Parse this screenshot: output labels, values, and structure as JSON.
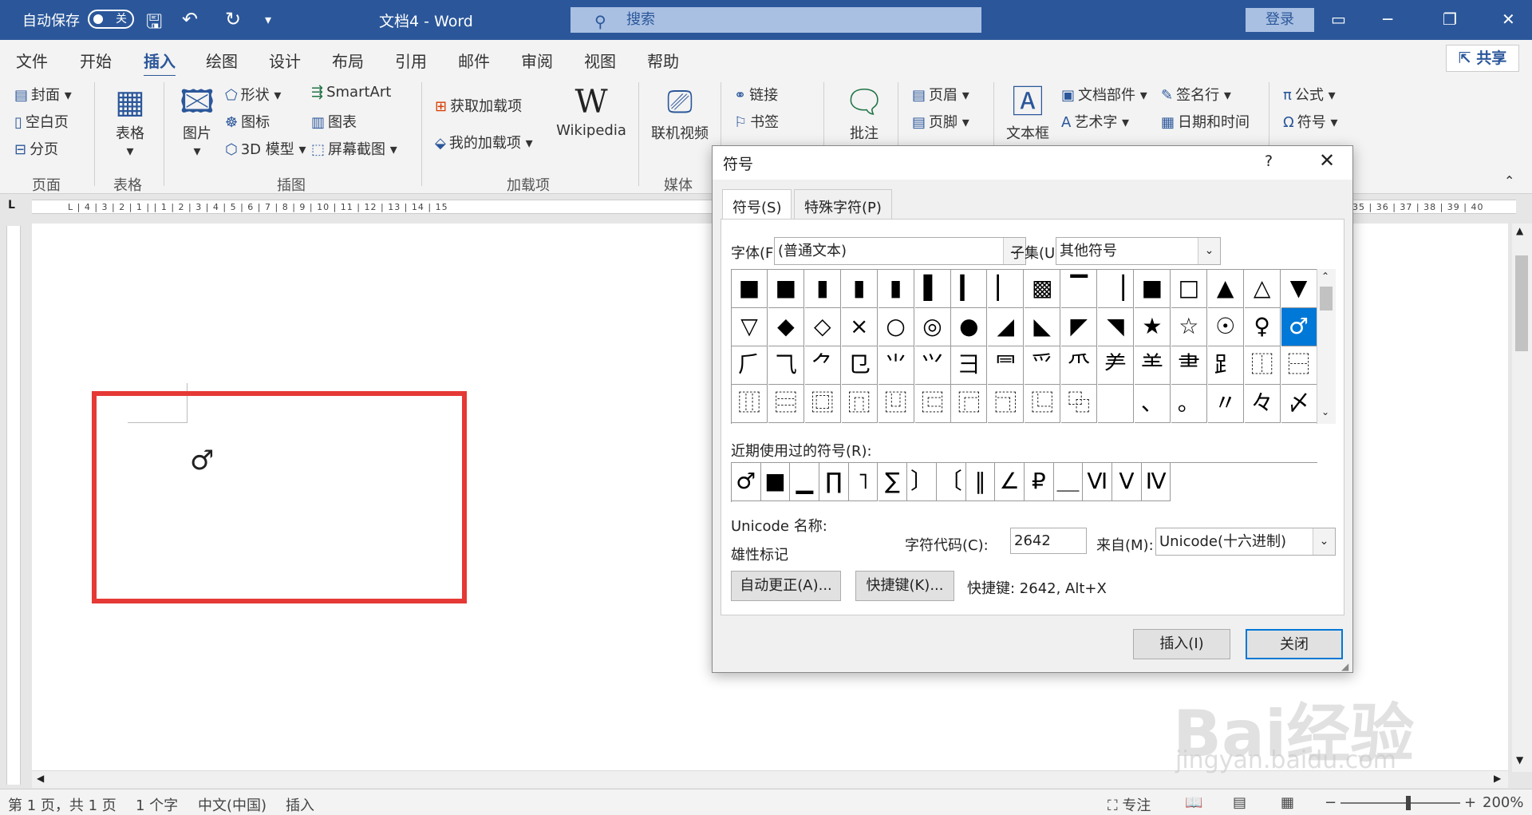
{
  "titlebar": {
    "autosave_label": "自动保存",
    "autosave_state": "关",
    "doc_title": "文档4  -  Word",
    "search_placeholder": "搜索",
    "login": "登录"
  },
  "menu": {
    "items": [
      "文件",
      "开始",
      "插入",
      "绘图",
      "设计",
      "布局",
      "引用",
      "邮件",
      "审阅",
      "视图",
      "帮助"
    ],
    "active": "插入",
    "share": "共享"
  },
  "ribbon": {
    "pages": {
      "cover": "封面",
      "blank": "空白页",
      "break": "分页",
      "group": "页面"
    },
    "tables": {
      "table": "表格",
      "group": "表格"
    },
    "illustrations": {
      "pictures": "图片",
      "shapes": "形状",
      "icons": "图标",
      "models": "3D 模型",
      "smartart": "SmartArt",
      "chart": "图表",
      "screenshot": "屏幕截图",
      "group": "插图"
    },
    "addins": {
      "get": "获取加载项",
      "mine": "我的加载项",
      "wikipedia": "Wikipedia",
      "group": "加载项"
    },
    "media": {
      "video": "联机视频",
      "group": "媒体"
    },
    "links": {
      "link": "链接",
      "bookmark": "书签"
    },
    "comments": {
      "comment": "批注"
    },
    "header": {
      "header": "页眉",
      "footer": "页脚"
    },
    "text": {
      "textbox": "文本框",
      "parts": "文档部件",
      "wordart": "艺术字",
      "signature": "签名行",
      "datetime": "日期和时间"
    },
    "symbols": {
      "equation": "公式",
      "symbol": "符号"
    }
  },
  "ruler": {
    "numbers": "L   | 4 | 3 | 2 | 1 |     | 1 | 2 | 3 | 4 | 5 | 6 | 7 | 8 | 9 | 10 | 11 | 12 | 13 | 14 | 15",
    "right": "35 | 36 | 37 | 38 | 39 | 40"
  },
  "document": {
    "symbol": "♂"
  },
  "status": {
    "page": "第 1 页，共 1 页",
    "words": "1 个字",
    "lang": "中文(中国)",
    "mode": "插入",
    "focus": "专注",
    "zoom": "200%"
  },
  "dialog": {
    "title": "符号",
    "help": "?",
    "tabs": [
      "符号(S)",
      "特殊字符(P)"
    ],
    "font_label": "字体(F):",
    "font_value": "(普通文本)",
    "subset_label": "子集(U):",
    "subset_value": "其他符号",
    "grid": [
      [
        "■",
        "■",
        "▮",
        "▮",
        "▮",
        "▌",
        "▎",
        "▏",
        "▩",
        "▔",
        "▕",
        "■",
        "□",
        "▲",
        "△",
        "▼"
      ],
      [
        "▽",
        "◆",
        "◇",
        "×",
        "○",
        "◎",
        "●",
        "◢",
        "◣",
        "◤",
        "◥",
        "★",
        "☆",
        "☉",
        "♀",
        "♂"
      ],
      [
        "⺁",
        "⺄",
        "⺈",
        "⺋",
        "⺌",
        "⺍",
        "⺕",
        "⺜",
        "⺤",
        "⺥",
        "⺶",
        "⺷",
        "⺻",
        "⻊",
        "⿰",
        "⿱"
      ],
      [
        "⿲",
        "⿳",
        "⿴",
        "⿵",
        "⿶",
        "⿷",
        "⿸",
        "⿹",
        "⿺",
        "⿻",
        " ",
        "、",
        "。",
        "〃",
        "々",
        "〆"
      ]
    ],
    "recent_label": "近期使用过的符号(R):",
    "recent": [
      "♂",
      "■",
      "▁",
      "∏",
      "˥",
      "∑",
      "〕",
      "〔",
      "‖",
      "∠",
      "₽",
      "＿",
      "Ⅵ",
      "Ⅴ",
      "Ⅳ"
    ],
    "unicode_name_label": "Unicode 名称:",
    "unicode_name": "雄性标记",
    "code_label": "字符代码(C):",
    "code_value": "2642",
    "from_label": "来自(M):",
    "from_value": "Unicode(十六进制)",
    "autocorrect": "自动更正(A)...",
    "shortcut_key": "快捷键(K)...",
    "shortcut_text": "快捷键: 2642, Alt+X",
    "insert": "插入(I)",
    "close": "关闭"
  },
  "watermark": {
    "main": "Bai经验",
    "sub": "jingyan.baidu.com"
  }
}
